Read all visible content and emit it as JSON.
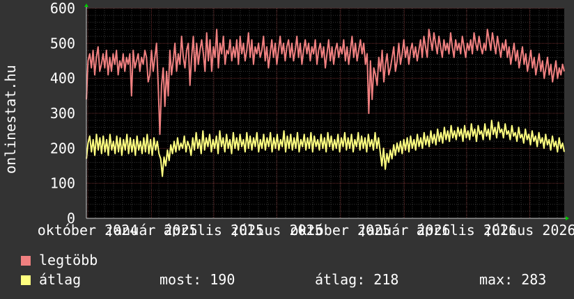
{
  "chart_data": {
    "type": "line",
    "ylabel": "onlinestat.hu",
    "ylim": [
      0,
      600
    ],
    "y_ticks": [
      "0",
      "100",
      "200",
      "300",
      "400",
      "500",
      "600"
    ],
    "x_ticks": [
      "október 2024",
      "január 2025",
      "április 2025",
      "július 2025",
      "október 2025",
      "január 2026",
      "április 2026",
      "július 2026"
    ],
    "xlim": [
      "2024-09-29",
      "2026-08-20"
    ],
    "grid": true,
    "series": [
      {
        "name": "legtöbb",
        "color": "#f08080",
        "values": [
          340,
          450,
          470,
          430,
          480,
          410,
          460,
          490,
          420,
          440,
          470,
          430,
          480,
          410,
          460,
          420,
          470,
          440,
          480,
          410,
          450,
          430,
          470,
          420,
          460,
          440,
          470,
          350,
          480,
          430,
          450,
          470,
          420,
          460,
          440,
          480,
          460,
          390,
          410,
          480,
          420,
          460,
          500,
          380,
          240,
          380,
          430,
          320,
          420,
          350,
          480,
          410,
          450,
          500,
          420,
          470,
          440,
          520,
          460,
          430,
          480,
          500,
          380,
          460,
          520,
          420,
          500,
          440,
          480,
          510,
          470,
          420,
          530,
          450,
          510,
          420,
          490,
          460,
          540,
          430,
          500,
          470,
          520,
          440,
          480,
          470,
          510,
          450,
          490,
          460,
          510,
          440,
          520,
          470,
          500,
          450,
          480,
          530,
          460,
          510,
          440,
          490,
          470,
          500,
          460,
          480,
          520,
          450,
          490,
          430,
          470,
          510,
          460,
          500,
          440,
          480,
          520,
          470,
          500,
          450,
          490,
          510,
          460,
          500,
          450,
          480,
          520,
          460,
          500,
          440,
          480,
          510,
          470,
          500,
          450,
          490,
          470,
          510,
          440,
          480,
          500,
          460,
          490,
          430,
          470,
          510,
          450,
          490,
          440,
          480,
          500,
          460,
          490,
          470,
          510,
          450,
          490,
          440,
          480,
          520,
          460,
          500,
          450,
          480,
          510,
          470,
          500,
          440,
          470,
          300,
          450,
          340,
          430,
          410,
          380,
          460,
          420,
          480,
          390,
          440,
          470,
          410,
          430,
          460,
          490,
          420,
          450,
          500,
          440,
          470,
          510,
          460,
          490,
          440,
          480,
          500,
          460,
          490,
          450,
          480,
          510,
          460,
          520,
          490,
          460,
          540,
          510,
          480,
          530,
          500,
          470,
          520,
          490,
          460,
          510,
          480,
          500,
          470,
          530,
          490,
          460,
          510,
          480,
          500,
          470,
          520,
          490,
          460,
          500,
          480,
          510,
          470,
          530,
          500,
          480,
          520,
          490,
          470,
          500,
          480,
          540,
          510,
          480,
          530,
          500,
          470,
          520,
          490,
          460,
          500,
          480,
          510,
          460,
          490,
          440,
          470,
          500,
          450,
          480,
          430,
          460,
          490,
          440,
          470,
          420,
          450,
          480,
          430,
          460,
          410,
          440,
          470,
          420,
          450,
          400,
          430,
          460,
          410,
          440,
          390,
          420,
          450,
          400,
          430,
          410,
          440,
          420
        ]
      },
      {
        "name": "átlag",
        "color": "#ffff80",
        "values": [
          170,
          215,
          235,
          190,
          225,
          180,
          240,
          195,
          230,
          185,
          235,
          190,
          225,
          180,
          240,
          195,
          220,
          185,
          235,
          190,
          230,
          180,
          225,
          195,
          240,
          185,
          230,
          190,
          225,
          180,
          235,
          195,
          220,
          185,
          230,
          190,
          240,
          185,
          225,
          180,
          230,
          195,
          220,
          185,
          170,
          120,
          175,
          150,
          195,
          165,
          210,
          185,
          220,
          190,
          230,
          195,
          215,
          200,
          235,
          190,
          220,
          205,
          180,
          230,
          195,
          245,
          200,
          225,
          185,
          250,
          195,
          230,
          205,
          240,
          190,
          225,
          200,
          235,
          185,
          250,
          205,
          230,
          190,
          240,
          200,
          225,
          185,
          245,
          200,
          230,
          195,
          240,
          205,
          225,
          190,
          245,
          200,
          235,
          195,
          230,
          205,
          245,
          190,
          225,
          200,
          240,
          195,
          230,
          205,
          245,
          190,
          230,
          200,
          240,
          195,
          225,
          205,
          250,
          190,
          235,
          200,
          240,
          195,
          230,
          200,
          245,
          190,
          225,
          205,
          240,
          195,
          230,
          200,
          245,
          190,
          235,
          205,
          225,
          195,
          240,
          200,
          230,
          190,
          245,
          205,
          235,
          195,
          225,
          200,
          240,
          190,
          230,
          205,
          245,
          195,
          230,
          200,
          240,
          190,
          225,
          205,
          245,
          195,
          235,
          200,
          230,
          190,
          240,
          205,
          225,
          195,
          245,
          200,
          230,
          190,
          150,
          200,
          140,
          185,
          160,
          195,
          170,
          210,
          180,
          215,
          190,
          220,
          185,
          225,
          195,
          230,
          190,
          235,
          200,
          225,
          195,
          240,
          205,
          230,
          200,
          245,
          210,
          235,
          205,
          250,
          215,
          240,
          210,
          255,
          220,
          245,
          215,
          260,
          225,
          250,
          220,
          265,
          230,
          250,
          225,
          260,
          235,
          255,
          220,
          265,
          230,
          250,
          225,
          270,
          235,
          255,
          220,
          265,
          240,
          250,
          225,
          270,
          235,
          255,
          225,
          280,
          240,
          260,
          230,
          275,
          245,
          255,
          230,
          270,
          240,
          250,
          225,
          265,
          235,
          245,
          220,
          260,
          230,
          240,
          215,
          255,
          225,
          240,
          210,
          250,
          220,
          235,
          205,
          245,
          215,
          230,
          200,
          240,
          210,
          225,
          195,
          235,
          205,
          220,
          190,
          230,
          200,
          215,
          190
        ]
      }
    ]
  },
  "legend": [
    {
      "label": "legtöbb",
      "color": "#f08080"
    },
    {
      "label": "átlag",
      "color": "#ffff80"
    }
  ],
  "stats": {
    "most": "most: 190",
    "atlag": "átlag: 218",
    "max": "max: 283"
  }
}
